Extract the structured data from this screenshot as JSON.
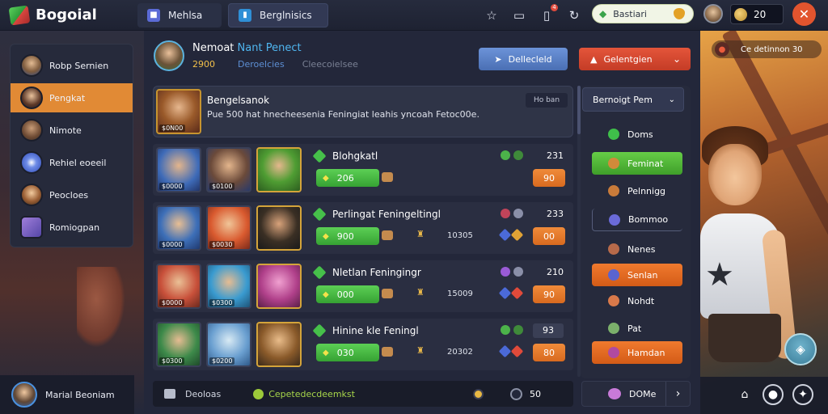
{
  "app": {
    "logo_text": "Bogoial",
    "tabs": [
      {
        "label": "Mehlsa",
        "icon": "game-icon"
      },
      {
        "label": "Berglnisics",
        "icon": "store-icon"
      }
    ],
    "notification_count": "4",
    "search": {
      "text": "Bastiari"
    },
    "coins": "20",
    "close_icon": "close-icon"
  },
  "sidebar": {
    "items": [
      {
        "label": "Robp Sernien",
        "icon": "avatar-icon",
        "active": false
      },
      {
        "label": "Pengkat",
        "icon": "avatar-icon",
        "active": true
      },
      {
        "label": "Nimote",
        "icon": "avatar-icon",
        "active": false
      },
      {
        "label": "Rehiel eoeeil",
        "icon": "star-icon",
        "active": false
      },
      {
        "label": "Peocloes",
        "icon": "avatar-icon",
        "active": false
      },
      {
        "label": "Romiogpan",
        "icon": "puzzle-icon",
        "active": false
      }
    ],
    "user": {
      "name": "Marial Beoniam"
    }
  },
  "profile": {
    "name_prefix": "Nemoat",
    "name_highlight": "Nant Penect",
    "gold": "2900",
    "rank_label": "Deroelcies",
    "extra_label": "Cleecoielsee"
  },
  "actions": {
    "primary_label": "Dellecleld",
    "secondary_label": "Gelentgien"
  },
  "featured": {
    "title": "Bengelsanok",
    "description": "Pue 500 hat hnecheesenia Feningiat leahis yncoah Fetoc00e.",
    "badge": "Ho ban",
    "card_label": "$0N00"
  },
  "rows": [
    {
      "title": "Blohgkatl",
      "cards": [
        "$0000",
        "$0100",
        ""
      ],
      "pill_value": "206",
      "score": "",
      "value": "231",
      "action_value": "90"
    },
    {
      "title": "Perlingat Feningeltingl",
      "cards": [
        "$0000",
        "$0030",
        ""
      ],
      "pill_value": "900",
      "score": "10305",
      "value": "233",
      "action_value": "00"
    },
    {
      "title": "Nletlan Feningingr",
      "cards": [
        "$0000",
        "$0300",
        ""
      ],
      "pill_value": "000",
      "score": "15009",
      "value": "210",
      "action_value": "90"
    },
    {
      "title": "Hinine kle Feningl",
      "cards": [
        "$0300",
        "$0200",
        ""
      ],
      "pill_value": "030",
      "score": "20302",
      "value": "93",
      "action_value": "80"
    }
  ],
  "filter": {
    "header": "Bernoigt Pem",
    "items": [
      {
        "label": "Doms",
        "style": "plain",
        "icon_color": "#3fbf4a"
      },
      {
        "label": "Feminat",
        "style": "green",
        "icon_color": "#d28a3a"
      },
      {
        "label": "Pelnnigg",
        "style": "plain",
        "icon_color": "#c97b3a"
      },
      {
        "label": "Bommoo",
        "style": "outline",
        "icon_color": "#6a6ad8"
      },
      {
        "label": "Nenes",
        "style": "plain",
        "icon_color": "#b76a4a"
      },
      {
        "label": "Senlan",
        "style": "orange",
        "icon_color": "#5a64d0"
      },
      {
        "label": "Nohdt",
        "style": "plain",
        "icon_color": "#d9794a"
      },
      {
        "label": "Pat",
        "style": "plain",
        "icon_color": "#7bb06b"
      },
      {
        "label": "Hamdan",
        "style": "orange",
        "icon_color": "#b04aa0"
      }
    ]
  },
  "bottom_bar": {
    "left_label": "Deoloas",
    "green_label": "Cepetedecdeemkst",
    "number": "50"
  },
  "done_button": {
    "label": "DOMe"
  },
  "right_panel": {
    "pill_text": "Ce detinnon 30"
  },
  "colors": {
    "accent_orange": "#e18a35",
    "accent_green": "#4cbc45",
    "accent_red": "#e2542e",
    "accent_blue": "#5b85cf",
    "panel": "#23273a"
  }
}
